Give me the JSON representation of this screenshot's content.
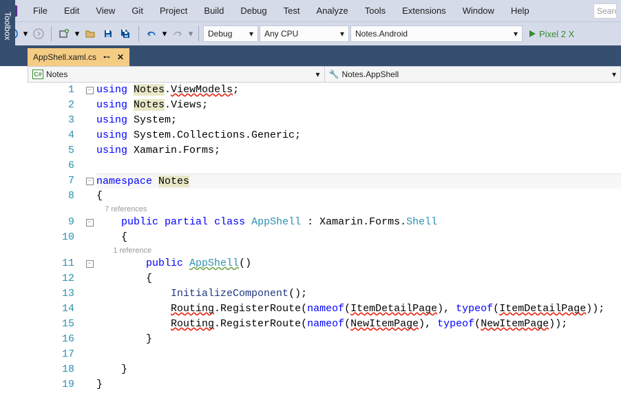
{
  "menu": {
    "items": [
      "File",
      "Edit",
      "View",
      "Git",
      "Project",
      "Build",
      "Debug",
      "Test",
      "Analyze",
      "Tools",
      "Extensions",
      "Window",
      "Help"
    ],
    "search_placeholder": "Search"
  },
  "toolbar": {
    "config": "Debug",
    "platform": "Any CPU",
    "target": "Notes.Android",
    "device": "Pixel 2 X"
  },
  "tab": {
    "toolbox": "Toolbox",
    "filename": "AppShell.xaml.cs"
  },
  "nav": {
    "left": "Notes",
    "right": "Notes.AppShell"
  },
  "codelens": {
    "class": "7 references",
    "ctor": "1 reference"
  },
  "code": {
    "lines": [
      {
        "n": 1,
        "fold": "minus",
        "t": [
          [
            "kw",
            "using"
          ],
          [
            "plain",
            " "
          ],
          [
            "hl plain",
            "Notes"
          ],
          [
            "plain",
            "."
          ],
          [
            "squiggle plain",
            "ViewModels"
          ],
          [
            "plain",
            ";"
          ]
        ]
      },
      {
        "n": 2,
        "t": [
          [
            "kw",
            "using"
          ],
          [
            "plain",
            " "
          ],
          [
            "hl plain",
            "Notes"
          ],
          [
            "plain",
            "."
          ],
          [
            "plain",
            "Views;"
          ]
        ]
      },
      {
        "n": 3,
        "t": [
          [
            "kw",
            "using"
          ],
          [
            "plain",
            " System;"
          ]
        ]
      },
      {
        "n": 4,
        "t": [
          [
            "kw",
            "using"
          ],
          [
            "plain",
            " System.Collections.Generic;"
          ]
        ]
      },
      {
        "n": 5,
        "t": [
          [
            "kw",
            "using"
          ],
          [
            "plain",
            " Xamarin.Forms;"
          ]
        ]
      },
      {
        "n": 6,
        "t": []
      },
      {
        "n": 7,
        "fold": "minus",
        "cls": "current-line outline-top",
        "t": [
          [
            "kw",
            "namespace"
          ],
          [
            "plain",
            " "
          ],
          [
            "hl plain",
            "Notes"
          ]
        ]
      },
      {
        "n": 8,
        "t": [
          [
            "plain",
            "{"
          ]
        ]
      },
      {
        "n": 0,
        "codelens": "class",
        "indent": "    "
      },
      {
        "n": 9,
        "fold": "minus",
        "t": [
          [
            "plain",
            "    "
          ],
          [
            "kw",
            "public"
          ],
          [
            "plain",
            " "
          ],
          [
            "kw",
            "partial"
          ],
          [
            "plain",
            " "
          ],
          [
            "kw",
            "class"
          ],
          [
            "plain",
            " "
          ],
          [
            "type",
            "AppShell"
          ],
          [
            "plain",
            " : Xamarin.Forms."
          ],
          [
            "type",
            "Shell"
          ]
        ]
      },
      {
        "n": 10,
        "t": [
          [
            "plain",
            "    {"
          ]
        ]
      },
      {
        "n": 0,
        "codelens": "ctor",
        "indent": "        "
      },
      {
        "n": 11,
        "fold": "minus",
        "t": [
          [
            "plain",
            "        "
          ],
          [
            "kw",
            "public"
          ],
          [
            "plain",
            " "
          ],
          [
            "type squiggle-g",
            "AppShell"
          ],
          [
            "plain",
            "()"
          ]
        ]
      },
      {
        "n": 12,
        "t": [
          [
            "plain",
            "        {"
          ]
        ]
      },
      {
        "n": 13,
        "t": [
          [
            "plain",
            "            "
          ],
          [
            "ident",
            "InitializeComponent"
          ],
          [
            "plain",
            "();"
          ]
        ]
      },
      {
        "n": 14,
        "t": [
          [
            "plain",
            "            "
          ],
          [
            "squiggle plain",
            "Routing"
          ],
          [
            "plain",
            ".RegisterRoute("
          ],
          [
            "kw",
            "nameof"
          ],
          [
            "plain",
            "("
          ],
          [
            "squiggle plain",
            "ItemDetailPage"
          ],
          [
            "plain",
            "), "
          ],
          [
            "kw",
            "typeof"
          ],
          [
            "plain",
            "("
          ],
          [
            "squiggle plain",
            "ItemDetailPage"
          ],
          [
            "plain",
            "));"
          ]
        ]
      },
      {
        "n": 15,
        "t": [
          [
            "plain",
            "            "
          ],
          [
            "squiggle plain",
            "Routing"
          ],
          [
            "plain",
            ".RegisterRoute("
          ],
          [
            "kw",
            "nameof"
          ],
          [
            "plain",
            "("
          ],
          [
            "squiggle plain",
            "NewItemPage"
          ],
          [
            "plain",
            "), "
          ],
          [
            "kw",
            "typeof"
          ],
          [
            "plain",
            "("
          ],
          [
            "squiggle plain",
            "NewItemPage"
          ],
          [
            "plain",
            "));"
          ]
        ]
      },
      {
        "n": 16,
        "t": [
          [
            "plain",
            "        }"
          ]
        ]
      },
      {
        "n": 17,
        "t": []
      },
      {
        "n": 18,
        "t": [
          [
            "plain",
            "    }"
          ]
        ]
      },
      {
        "n": 19,
        "t": [
          [
            "plain",
            "}"
          ]
        ]
      }
    ]
  }
}
